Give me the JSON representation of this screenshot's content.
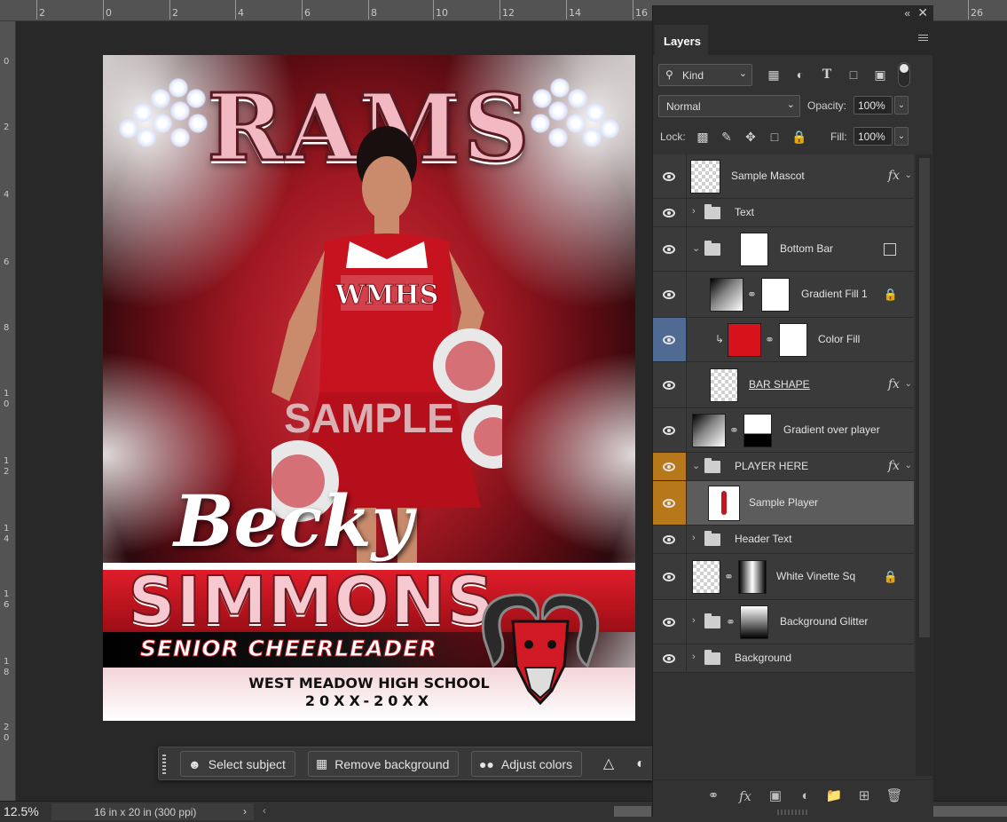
{
  "ruler": {
    "top_ticks": [
      "2",
      "0",
      "2",
      "4",
      "6",
      "8",
      "10",
      "12",
      "14",
      "16",
      "26"
    ],
    "left_ticks": [
      "0",
      "2",
      "4",
      "6",
      "8",
      "1\n0",
      "1\n2",
      "1\n4",
      "1\n6",
      "1\n8",
      "2\n0"
    ]
  },
  "artwork": {
    "team_title": "RAMS",
    "watermark": "SAMPLE",
    "first_name": "Becky",
    "last_name": "SIMMONS",
    "role": "SENIOR CHEERLEADER",
    "school": "WEST MEADOW HIGH SCHOOL",
    "years": "20XX-20XX",
    "uniform_letters": "WMHS"
  },
  "taskbar": {
    "select_subject": "Select subject",
    "remove_background": "Remove background",
    "adjust_colors": "Adjust colors",
    "more": "•••"
  },
  "status": {
    "zoom": "12.5%",
    "doc_info": "16 in x 20 in (300 ppi)"
  },
  "panel": {
    "tab": "Layers",
    "kind": "Kind",
    "blend_mode": "Normal",
    "opacity_label": "Opacity:",
    "opacity": "100%",
    "lock_label": "Lock:",
    "fill_label": "Fill:",
    "fill": "100%"
  },
  "layers": [
    {
      "name": "Sample Mascot",
      "type": "raster"
    },
    {
      "name": "Text",
      "type": "group"
    },
    {
      "name": "Bottom Bar",
      "type": "group-open"
    },
    {
      "name": "Gradient Fill 1",
      "type": "fill"
    },
    {
      "name": "Color Fill",
      "type": "fill"
    },
    {
      "name": "BAR SHAPE",
      "type": "shape"
    },
    {
      "name": "Gradient over player",
      "type": "fill"
    },
    {
      "name": "PLAYER HERE",
      "type": "group-open"
    },
    {
      "name": "Sample Player",
      "type": "raster"
    },
    {
      "name": "Header Text",
      "type": "group"
    },
    {
      "name": "White Vinette Sq",
      "type": "raster"
    },
    {
      "name": "Background Glitter",
      "type": "group"
    },
    {
      "name": "Background",
      "type": "group"
    }
  ],
  "icons": {
    "eye": "eye-icon",
    "folder": "folder-icon",
    "fx": "fx",
    "lock": "lock-icon"
  },
  "colors": {
    "selection_highlight": "#5c5c5c",
    "color_fill": "#d8121c",
    "eye_blue": "#4f6b94",
    "eye_orange": "#b7781b"
  }
}
